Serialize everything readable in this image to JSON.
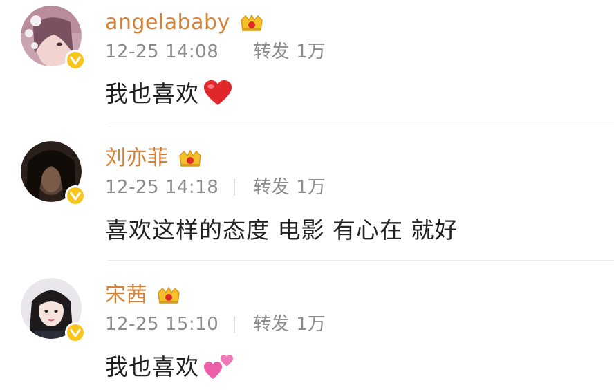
{
  "feed": {
    "posts": [
      {
        "username": "angelababy",
        "timestamp": "12-25 14:08",
        "repost_label": "转发",
        "repost_count": "1万",
        "comment": "我也喜欢",
        "emoji": "red-heart"
      },
      {
        "username": "刘亦菲",
        "timestamp": "12-25 14:18",
        "repost_label": "转发",
        "repost_count": "1万",
        "comment": "喜欢这样的态度 电影 有心在 就好",
        "emoji": ""
      },
      {
        "username": "宋茜",
        "timestamp": "12-25 15:10",
        "repost_label": "转发",
        "repost_count": "1万",
        "comment": "我也喜欢",
        "emoji": "two-pink-hearts"
      }
    ]
  },
  "colors": {
    "username": "#d3823a",
    "meta_text": "#8c8c8c",
    "comment_text": "#222222",
    "verified_badge": "#f7c51c",
    "heart_red": "#e0272a",
    "heart_pink": "#ec5fa8"
  }
}
